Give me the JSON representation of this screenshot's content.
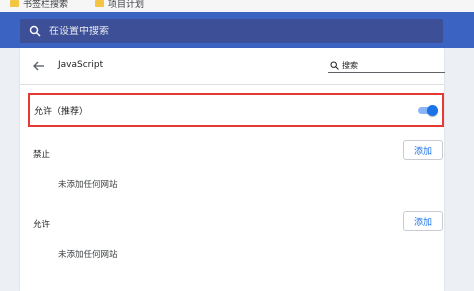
{
  "bookmarks": [
    {
      "label": "书签栏搜索"
    },
    {
      "label": "项目计划"
    }
  ],
  "header": {
    "search_placeholder": "在设置中搜索"
  },
  "page": {
    "title": "JavaScript",
    "search_placeholder": "搜索"
  },
  "default_setting": {
    "label": "允许（推荐）",
    "enabled": true,
    "accent_color": "#1a73e8"
  },
  "sections": {
    "block": {
      "label": "禁止",
      "add_label": "添加",
      "empty_text": "未添加任何网站"
    },
    "allow": {
      "label": "允许",
      "add_label": "添加",
      "empty_text": "未添加任何网站"
    }
  }
}
